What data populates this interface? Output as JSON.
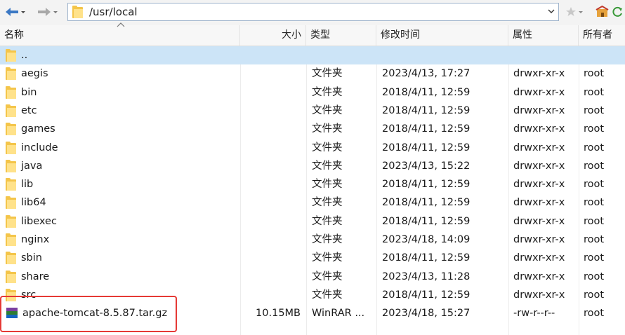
{
  "toolbar": {
    "back_icon": "arrow-left-icon",
    "forward_icon": "arrow-right-icon",
    "path": "/usr/local",
    "star_icon": "star-icon",
    "home_icon": "home-icon"
  },
  "columns": {
    "name": "名称",
    "size": "大小",
    "type": "类型",
    "modified": "修改时间",
    "attributes": "属性",
    "owner": "所有者"
  },
  "parent_row": {
    "name": ".."
  },
  "files": [
    {
      "name": "aegis",
      "size": "",
      "type": "文件夹",
      "modified": "2023/4/13, 17:27",
      "attr": "drwxr-xr-x",
      "owner": "root",
      "icon": "folder-icon"
    },
    {
      "name": "bin",
      "size": "",
      "type": "文件夹",
      "modified": "2018/4/11, 12:59",
      "attr": "drwxr-xr-x",
      "owner": "root",
      "icon": "folder-icon"
    },
    {
      "name": "etc",
      "size": "",
      "type": "文件夹",
      "modified": "2018/4/11, 12:59",
      "attr": "drwxr-xr-x",
      "owner": "root",
      "icon": "folder-icon"
    },
    {
      "name": "games",
      "size": "",
      "type": "文件夹",
      "modified": "2018/4/11, 12:59",
      "attr": "drwxr-xr-x",
      "owner": "root",
      "icon": "folder-icon"
    },
    {
      "name": "include",
      "size": "",
      "type": "文件夹",
      "modified": "2018/4/11, 12:59",
      "attr": "drwxr-xr-x",
      "owner": "root",
      "icon": "folder-icon"
    },
    {
      "name": "java",
      "size": "",
      "type": "文件夹",
      "modified": "2023/4/13, 15:22",
      "attr": "drwxr-xr-x",
      "owner": "root",
      "icon": "folder-icon"
    },
    {
      "name": "lib",
      "size": "",
      "type": "文件夹",
      "modified": "2018/4/11, 12:59",
      "attr": "drwxr-xr-x",
      "owner": "root",
      "icon": "folder-icon"
    },
    {
      "name": "lib64",
      "size": "",
      "type": "文件夹",
      "modified": "2018/4/11, 12:59",
      "attr": "drwxr-xr-x",
      "owner": "root",
      "icon": "folder-icon"
    },
    {
      "name": "libexec",
      "size": "",
      "type": "文件夹",
      "modified": "2018/4/11, 12:59",
      "attr": "drwxr-xr-x",
      "owner": "root",
      "icon": "folder-icon"
    },
    {
      "name": "nginx",
      "size": "",
      "type": "文件夹",
      "modified": "2023/4/18, 14:09",
      "attr": "drwxr-xr-x",
      "owner": "root",
      "icon": "folder-icon"
    },
    {
      "name": "sbin",
      "size": "",
      "type": "文件夹",
      "modified": "2018/4/11, 12:59",
      "attr": "drwxr-xr-x",
      "owner": "root",
      "icon": "folder-icon"
    },
    {
      "name": "share",
      "size": "",
      "type": "文件夹",
      "modified": "2023/4/13, 11:28",
      "attr": "drwxr-xr-x",
      "owner": "root",
      "icon": "folder-icon"
    },
    {
      "name": "src",
      "size": "",
      "type": "文件夹",
      "modified": "2018/4/11, 12:59",
      "attr": "drwxr-xr-x",
      "owner": "root",
      "icon": "folder-icon"
    },
    {
      "name": "apache-tomcat-8.5.87.tar.gz",
      "size": "10.15MB",
      "type": "WinRAR ...",
      "modified": "2023/4/18, 15:27",
      "attr": "-rw-r--r--",
      "owner": "root",
      "icon": "winrar-archive-icon"
    }
  ],
  "colors": {
    "selected_row": "#cce4f7",
    "highlight_box": "#e53935",
    "folder": "#f4c54a"
  }
}
